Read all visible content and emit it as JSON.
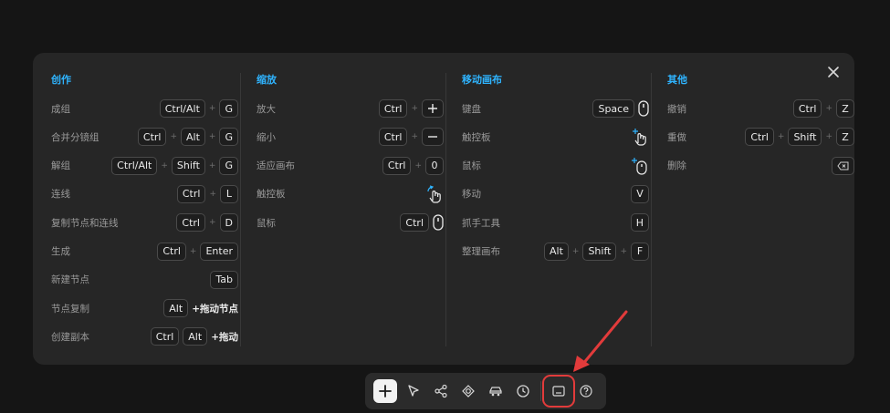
{
  "columns": [
    {
      "title": "创作",
      "rows": [
        {
          "label": "成组",
          "keys": [
            {
              "t": "Ctrl/Alt"
            },
            {
              "t": "G"
            }
          ]
        },
        {
          "label": "合并分镜组",
          "keys": [
            {
              "t": "Ctrl"
            },
            {
              "t": "Alt"
            },
            {
              "t": "G"
            }
          ]
        },
        {
          "label": "解组",
          "keys": [
            {
              "t": "Ctrl/Alt"
            },
            {
              "t": "Shift"
            },
            {
              "t": "G"
            }
          ]
        },
        {
          "label": "连线",
          "keys": [
            {
              "t": "Ctrl"
            },
            {
              "t": "L"
            }
          ]
        },
        {
          "label": "复制节点和连线",
          "keys": [
            {
              "t": "Ctrl"
            },
            {
              "t": "D"
            }
          ]
        },
        {
          "label": "生成",
          "keys": [
            {
              "t": "Ctrl"
            },
            {
              "t": "Enter"
            }
          ]
        },
        {
          "label": "新建节点",
          "keys": [
            {
              "t": "Tab"
            }
          ]
        },
        {
          "label": "节点复制",
          "keys": [
            {
              "t": "Alt"
            }
          ],
          "suffix": "+拖动节点"
        },
        {
          "label": "创建副本",
          "keys": [
            {
              "t": "Ctrl"
            },
            {
              "t": "Alt"
            }
          ],
          "nojoin": true,
          "suffix": "+拖动"
        }
      ]
    },
    {
      "title": "缩放",
      "rows": [
        {
          "label": "放大",
          "keys": [
            {
              "t": "Ctrl"
            },
            {
              "icon": "plus-icon"
            }
          ]
        },
        {
          "label": "缩小",
          "keys": [
            {
              "t": "Ctrl"
            },
            {
              "icon": "minus-icon"
            }
          ]
        },
        {
          "label": "适应画布",
          "keys": [
            {
              "t": "Ctrl"
            },
            {
              "t": "0"
            }
          ]
        },
        {
          "label": "触控板",
          "keys": [],
          "gesture": "pinch-gesture-icon"
        },
        {
          "label": "鼠标",
          "keys": [
            {
              "t": "Ctrl"
            }
          ],
          "nojoin": true,
          "gesture_key": "mouse-icon"
        }
      ]
    },
    {
      "title": "移动画布",
      "rows": [
        {
          "label": "键盘",
          "keys": [
            {
              "t": "Space"
            }
          ],
          "nojoin": true,
          "gesture_key": "mouse-icon"
        },
        {
          "label": "触控板",
          "keys": [],
          "gesture": "two-finger-drag-icon"
        },
        {
          "label": "鼠标",
          "keys": [],
          "gesture": "mouse-drag-icon"
        },
        {
          "label": "移动",
          "keys": [
            {
              "t": "V"
            }
          ]
        },
        {
          "label": "抓手工具",
          "keys": [
            {
              "t": "H"
            }
          ]
        },
        {
          "label": "整理画布",
          "keys": [
            {
              "t": "Alt"
            },
            {
              "t": "Shift"
            },
            {
              "t": "F"
            }
          ]
        }
      ]
    },
    {
      "title": "其他",
      "rows": [
        {
          "label": "撤销",
          "keys": [
            {
              "t": "Ctrl"
            },
            {
              "t": "Z"
            }
          ]
        },
        {
          "label": "重做",
          "keys": [
            {
              "t": "Ctrl"
            },
            {
              "t": "Shift"
            },
            {
              "t": "Z"
            }
          ]
        },
        {
          "label": "删除",
          "keys": [
            {
              "icon": "backspace-icon"
            }
          ]
        }
      ]
    }
  ],
  "plus_sign": "+",
  "toolbar": [
    {
      "name": "add-button",
      "icon": "plus-icon",
      "active": true
    },
    {
      "name": "select-tool-button",
      "icon": "cursor-icon"
    },
    {
      "name": "connect-tool-button",
      "icon": "nodes-icon"
    },
    {
      "name": "assets-button",
      "icon": "shapes-icon"
    },
    {
      "name": "vehicle-button",
      "icon": "car-icon"
    },
    {
      "name": "history-button",
      "icon": "clock-icon"
    },
    {
      "name": "separator"
    },
    {
      "name": "shortcuts-button",
      "icon": "keyboard-icon",
      "highlighted": true
    },
    {
      "name": "help-button",
      "icon": "help-icon"
    }
  ],
  "colors": {
    "accent": "#2fb4ff",
    "highlight": "#e23b3b",
    "panel": "#262626",
    "background": "#151515"
  }
}
